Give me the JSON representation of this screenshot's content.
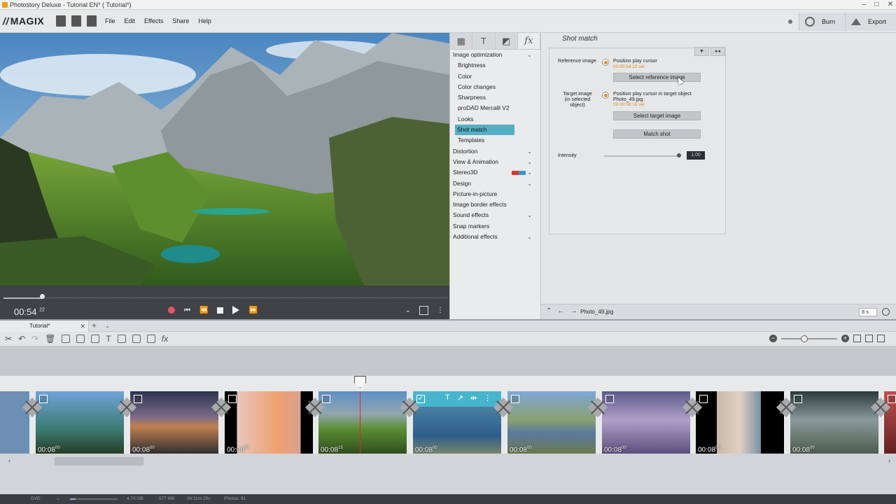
{
  "window": {
    "title": "Photostory Deluxe - Tutorial EN* ( Tutorial*)",
    "controls": [
      "–",
      "□",
      "✕"
    ]
  },
  "app": {
    "logo": "MAGIX"
  },
  "menu": [
    "File",
    "Edit",
    "Effects",
    "Share",
    "Help"
  ],
  "header_buttons": {
    "burn": "Burn",
    "export": "Export"
  },
  "transport": {
    "time_main": "00:54",
    "time_frames": "22"
  },
  "effects_tabs": [
    "media-pool",
    "titles",
    "transitions",
    "fx"
  ],
  "effects": [
    {
      "label": "Image optimization",
      "expandable": true
    },
    {
      "label": "Brightness",
      "sub": true
    },
    {
      "label": "Color",
      "sub": true
    },
    {
      "label": "Color changes",
      "sub": true
    },
    {
      "label": "Sharpness",
      "sub": true
    },
    {
      "label": "proDAD Mercalli V2",
      "sub": true
    },
    {
      "label": "Looks",
      "sub": true
    },
    {
      "label": "Shot match",
      "sub": true,
      "selected": true
    },
    {
      "label": "Templates",
      "sub": true
    },
    {
      "label": "Distortion",
      "expandable": true
    },
    {
      "label": "View & Animation",
      "expandable": true
    },
    {
      "label": "Stereo3D",
      "expandable": true
    },
    {
      "label": "Design",
      "expandable": true
    },
    {
      "label": "Picture-in-picture"
    },
    {
      "label": "Image border effects"
    },
    {
      "label": "Sound effects",
      "expandable": true
    },
    {
      "label": "Snap markers"
    },
    {
      "label": "Additional effects",
      "expandable": true
    }
  ],
  "shot_match": {
    "title": "Shot match",
    "reference_label": "Reference image",
    "reference_option": "Position play cursor",
    "reference_time": "00:00:54:22 set",
    "select_reference": "Select reference image",
    "target_label_1": "Target image",
    "target_label_2": "(in selected",
    "target_label_3": "object)",
    "target_option": "Position play cursor in target object",
    "target_file": "Photo_49.jpg",
    "target_time": "00:00:59:19 set",
    "select_target": "Select target image",
    "match_shot": "Match shot",
    "intensity_label": "Intensity",
    "intensity_value": "1.00"
  },
  "object_bar": {
    "filename": "Photo_49.jpg",
    "duration": "8 s"
  },
  "timeline": {
    "tab": "Tutorial*",
    "clips": [
      {
        "dur": "00:08",
        "frames": "00"
      },
      {
        "dur": "00:08",
        "frames": "00"
      },
      {
        "dur": "00:08",
        "frames": "00"
      },
      {
        "dur": "00:08",
        "frames": "15"
      },
      {
        "dur": "00:08",
        "frames": "00"
      },
      {
        "dur": "00:08",
        "frames": "00"
      },
      {
        "dur": "00:08",
        "frames": "00"
      },
      {
        "dur": "00:08",
        "frames": "00"
      },
      {
        "dur": "00:08",
        "frames": "00"
      }
    ]
  },
  "status": {
    "media": "DVD",
    "capacity": "4.70 GB",
    "size": "577 MB",
    "length": "0h:11m:25s",
    "photos": "Photos: 91"
  }
}
